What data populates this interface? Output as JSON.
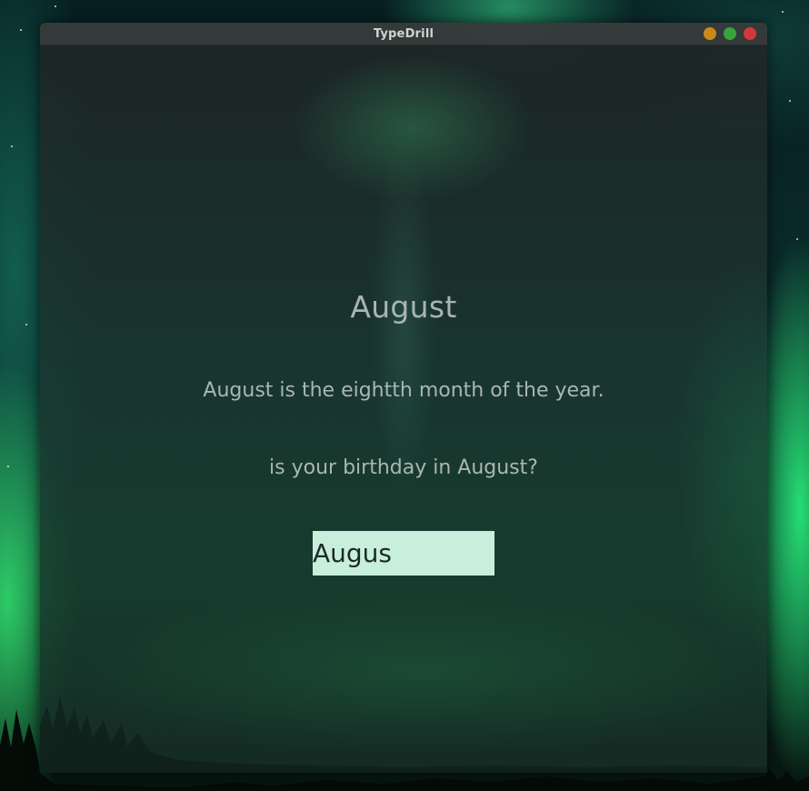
{
  "window": {
    "title": "TypeDrill",
    "controls": [
      "minimize-button",
      "maximize-button",
      "close-button"
    ]
  },
  "drill": {
    "word": "August",
    "sentences": [
      "August is the eightth month of the year.",
      "is your birthday in August?"
    ],
    "input_value": "Augus"
  },
  "colors": {
    "minimize": "#c9891d",
    "maximize": "#3aa43a",
    "close": "#d2393b",
    "input_background": "#c7efdc",
    "text": "#a9b6b2"
  }
}
